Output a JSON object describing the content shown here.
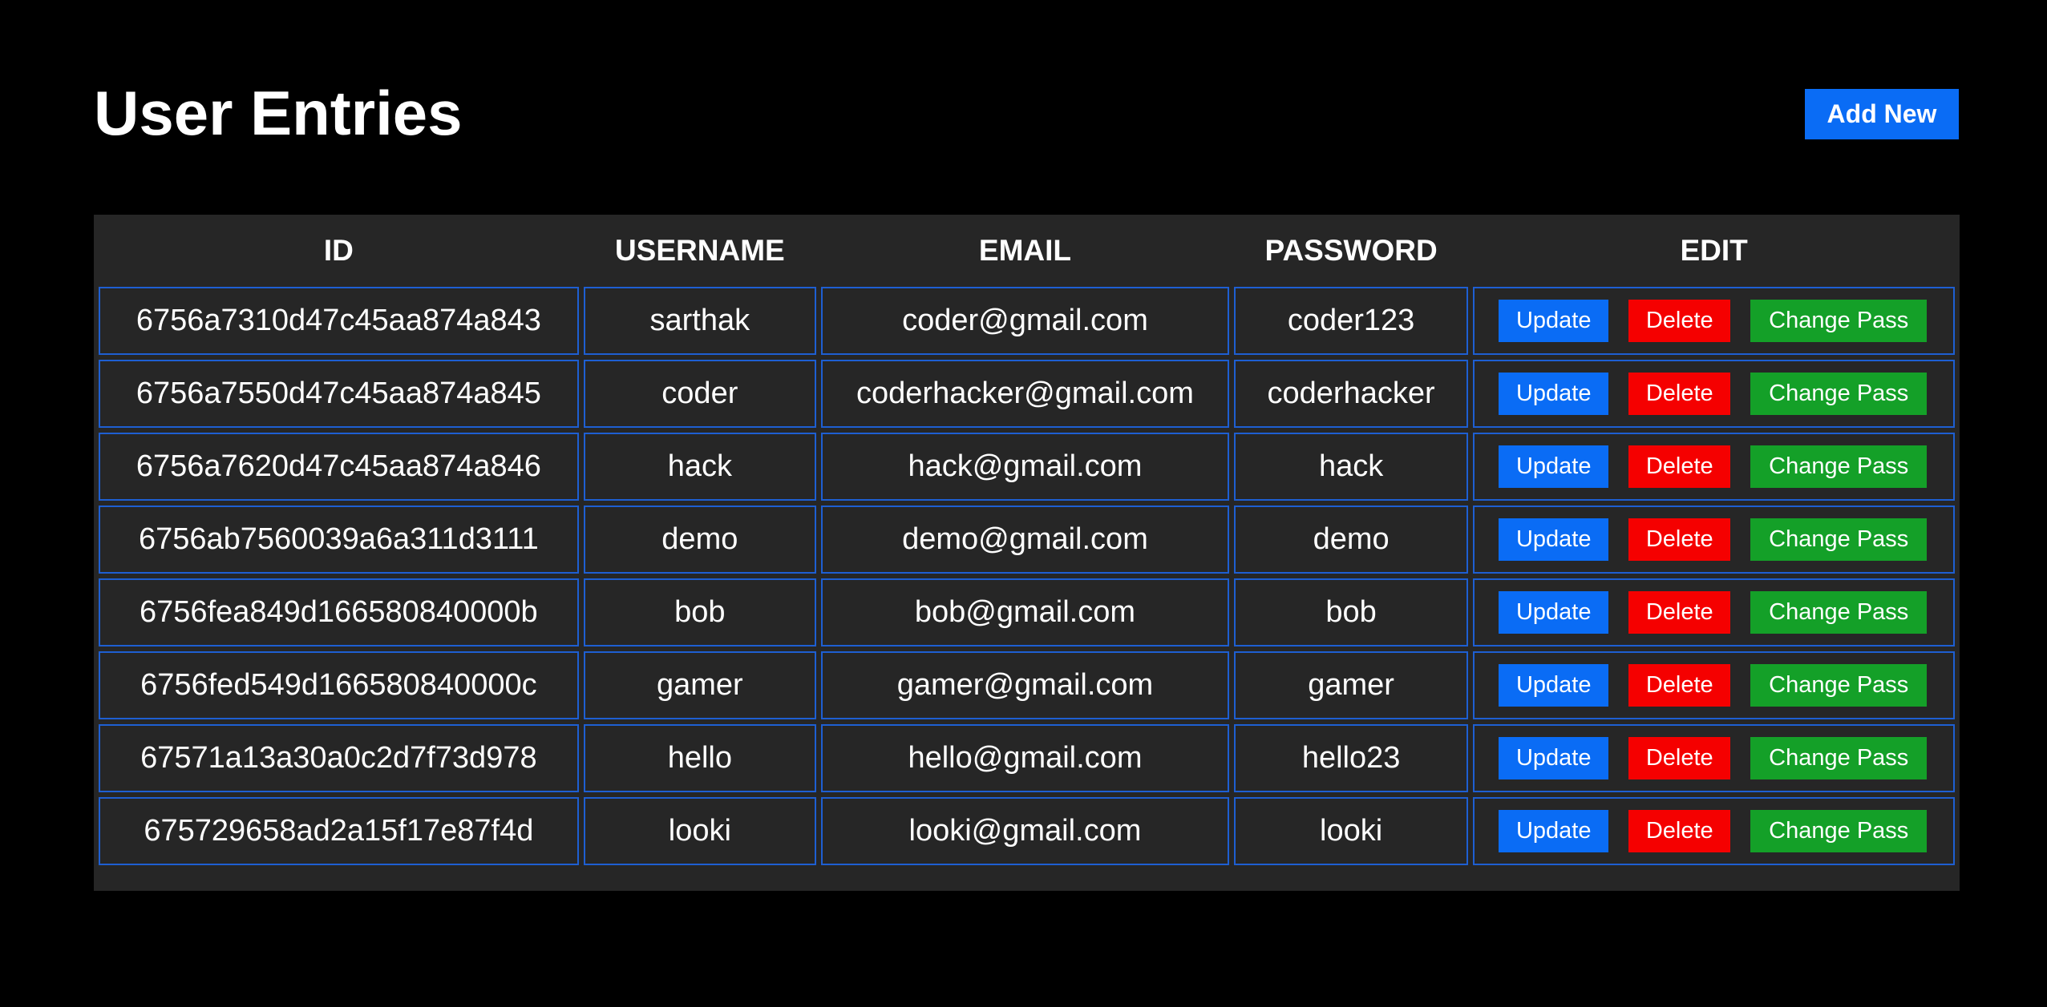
{
  "header": {
    "title": "User Entries",
    "add_new_label": "Add New"
  },
  "table": {
    "columns": [
      "ID",
      "USERNAME",
      "EMAIL",
      "PASSWORD",
      "EDIT"
    ],
    "actions": {
      "update": "Update",
      "delete": "Delete",
      "change_pass": "Change Pass"
    },
    "rows": [
      {
        "id": "6756a7310d47c45aa874a843",
        "username": "sarthak",
        "email": "coder@gmail.com",
        "password": "coder123"
      },
      {
        "id": "6756a7550d47c45aa874a845",
        "username": "coder",
        "email": "coderhacker@gmail.com",
        "password": "coderhacker"
      },
      {
        "id": "6756a7620d47c45aa874a846",
        "username": "hack",
        "email": "hack@gmail.com",
        "password": "hack"
      },
      {
        "id": "6756ab7560039a6a311d3111",
        "username": "demo",
        "email": "demo@gmail.com",
        "password": "demo"
      },
      {
        "id": "6756fea849d166580840000b",
        "username": "bob",
        "email": "bob@gmail.com",
        "password": "bob"
      },
      {
        "id": "6756fed549d166580840000c",
        "username": "gamer",
        "email": "gamer@gmail.com",
        "password": "gamer"
      },
      {
        "id": "67571a13a30a0c2d7f73d978",
        "username": "hello",
        "email": "hello@gmail.com",
        "password": "hello23"
      },
      {
        "id": "675729658ad2a15f17e87f4d",
        "username": "looki",
        "email": "looki@gmail.com",
        "password": "looki"
      }
    ]
  },
  "colors": {
    "background": "#000000",
    "table_background": "#262626",
    "cell_border": "#1e5fd2",
    "primary": "#0a6cf5",
    "danger": "#f50000",
    "success": "#14a028"
  }
}
